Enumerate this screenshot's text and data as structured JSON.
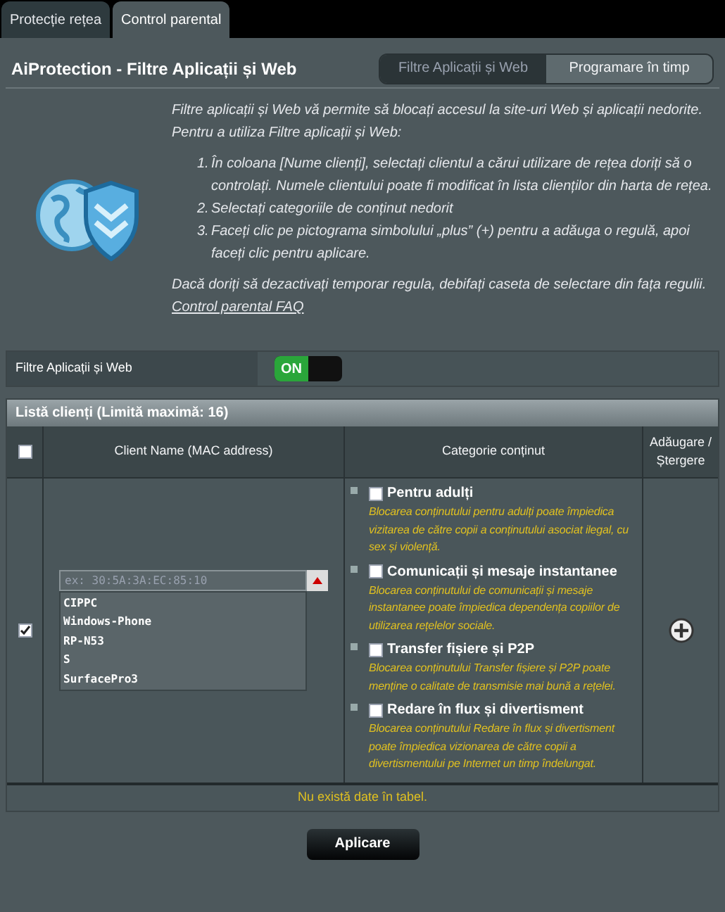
{
  "tabs": [
    {
      "label": "Protecție rețea",
      "selected": false
    },
    {
      "label": "Control parental",
      "selected": true
    }
  ],
  "title": "AiProtection - Filtre Aplicații și Web",
  "segments": [
    {
      "label": "Filtre Aplicații și Web",
      "selected": true
    },
    {
      "label": "Programare în timp",
      "selected": false
    }
  ],
  "intro": [
    "Filtre aplicații și Web vă permite să blocați accesul la site-uri Web și aplicații nedorite.",
    "Pentru a utiliza Filtre aplicații și Web:"
  ],
  "steps": [
    {
      "number": "1.",
      "text": "În coloana [Nume clienți], selectați clientul a cărui utilizare de rețea doriți să o controlați. Numele clientului poate fi modificat în lista clienților din harta de rețea."
    },
    {
      "number": "2.",
      "text": "Selectați categoriile de conținut nedorit"
    },
    {
      "number": "3.",
      "text": "Faceți clic pe pictograma simbolului „plus” (+) pentru a adăuga o regulă, apoi faceți clic pentru aplicare."
    }
  ],
  "note": "Dacă doriți să dezactivați temporar regula, debifați caseta de selectare din fața regulii.",
  "faq_link": "Control parental FAQ",
  "toggle": {
    "label": "Filtre Aplicații și Web",
    "state_label": "ON",
    "on": true
  },
  "table": {
    "title": "Listă clienți (Limită maximă: 16)",
    "select_all_checked": false,
    "columns": [
      "Client Name (MAC address)",
      "Categorie conținut",
      "Adăugare / Ștergere"
    ],
    "row": {
      "checked": true,
      "mac_placeholder": "ex: 30:5A:3A:EC:85:10",
      "dropdown_expanded": true,
      "clients": [
        "CIPPC",
        "Windows-Phone",
        "RP-N53",
        "S",
        "SurfacePro3"
      ],
      "categories": [
        {
          "label": "Pentru adulți",
          "checked": false,
          "description": "Blocarea conținutului pentru adulți poate împiedica vizitarea de către copii a conținutului asociat ilegal, cu sex și violență."
        },
        {
          "label": "Comunicații și mesaje instantanee",
          "checked": false,
          "description": "Blocarea conținutului de comunicații și mesaje instantanee poate împiedica dependența copiilor de utilizarea rețelelor sociale."
        },
        {
          "label": "Transfer fișiere și P2P",
          "checked": false,
          "description": "Blocarea conținutului Transfer fișiere și P2P poate menține o calitate de transmisie mai bună a rețelei."
        },
        {
          "label": "Redare în flux și divertisment",
          "checked": false,
          "description": "Blocarea conținutului Redare în flux și divertisment poate împiedica vizionarea de către copii a divertismentului pe Internet un timp îndelungat."
        }
      ]
    },
    "empty_message": "Nu există date în tabel."
  },
  "apply_button": "Aplicare"
}
